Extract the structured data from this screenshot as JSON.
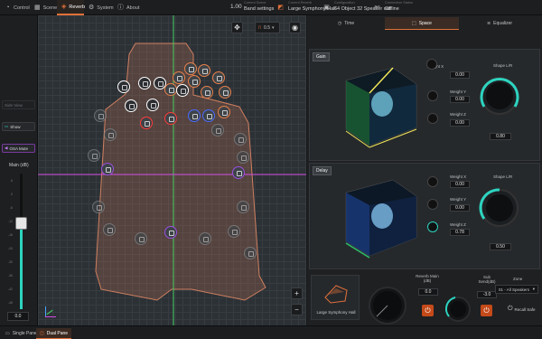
{
  "nav": {
    "tabs": [
      {
        "label": "Control",
        "icon": "gauge-icon"
      },
      {
        "label": "Scenes",
        "icon": "scenes-icon"
      },
      {
        "label": "Reverb",
        "icon": "reverb-icon"
      },
      {
        "label": "System",
        "icon": "gear-icon"
      },
      {
        "label": "About",
        "icon": "info-icon"
      }
    ],
    "active": "Reverb"
  },
  "status": {
    "scene_number": "1.00",
    "scene_label": "Current Scene",
    "scene_value": "Band settings",
    "reverb_label": "Current Reverb",
    "reverb_value": "Large Symphony Hall",
    "config_label": "Configuration",
    "config_value": "64 Object 32 Speaker out",
    "connection_label": "Connection Status",
    "connection_value": "Offline"
  },
  "left": {
    "side_view": "Side View",
    "show": "Show",
    "osa_mute": "OSA Mute",
    "main_label": "Main (dB)",
    "main_value": "0.0",
    "scale": [
      "6",
      "0",
      "-6",
      "-12",
      "-18",
      "-24",
      "-30",
      "-36",
      "-42",
      "-48"
    ]
  },
  "canvas": {
    "reverb_send_label": "0.5"
  },
  "right": {
    "tabs": [
      {
        "label": "Time",
        "icon": "clock-icon"
      },
      {
        "label": "Space",
        "icon": "space-icon"
      },
      {
        "label": "Equalizer",
        "icon": "eq-icon"
      }
    ],
    "active": "Space",
    "gain": {
      "title": "Gain",
      "weight_x_label": "Weight X",
      "weight_x": "0.00",
      "weight_y_label": "Weight Y",
      "weight_y": "0.00",
      "weight_z_label": "Weight Z",
      "weight_z": "0.00",
      "shape_label": "Shape L/R",
      "shape": "0.80"
    },
    "delay": {
      "title": "Delay",
      "weight_x_label": "Weight X",
      "weight_x": "0.00",
      "weight_y_label": "Weight Y",
      "weight_y": "0.00",
      "weight_z_label": "Weight Z",
      "weight_z": "0.78",
      "shape_label": "Shape L/R",
      "shape": "0.50"
    },
    "bottom": {
      "hall_name": "Large Symphony Hall",
      "reverb_main_label": "Reverb Main (dB)",
      "reverb_main": "0.0",
      "sub_send_label": "Sub Send(dB)",
      "sub_send": "-3.0",
      "zone_label": "Zone",
      "zone_value": "01 - All Speakers",
      "recall_label": "Recall Safe"
    }
  },
  "bottom_tabs": [
    {
      "label": "Single Pane"
    },
    {
      "label": "Dual Pane"
    }
  ],
  "bottom_active": "Dual Pane",
  "colors": {
    "accent": "#e0703a",
    "power": "#c44a1a",
    "teal": "#2dd4c0"
  }
}
